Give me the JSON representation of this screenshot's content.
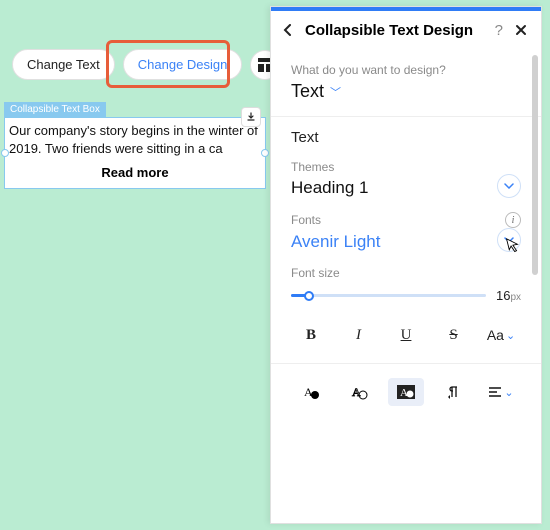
{
  "toolbar": {
    "change_text": "Change Text",
    "change_design": "Change Design"
  },
  "textbox": {
    "tag": "Collapsible Text Box",
    "body": "Our company's story begins in the winter of 2019. Two friends were sitting in a ca",
    "readmore": "Read more"
  },
  "panel": {
    "title": "Collapsible Text Design",
    "help": "?",
    "q_label": "What do you want to design?",
    "q_value": "Text",
    "section_text": "Text",
    "themes_label": "Themes",
    "themes_value": "Heading 1",
    "fonts_label": "Fonts",
    "fonts_value": "Avenir Light",
    "fontsize_label": "Font size",
    "fontsize_value": "16",
    "fontsize_unit": "px",
    "fmt": {
      "b": "B",
      "i": "I",
      "u": "U",
      "s": "S",
      "aa": "Aa"
    }
  }
}
